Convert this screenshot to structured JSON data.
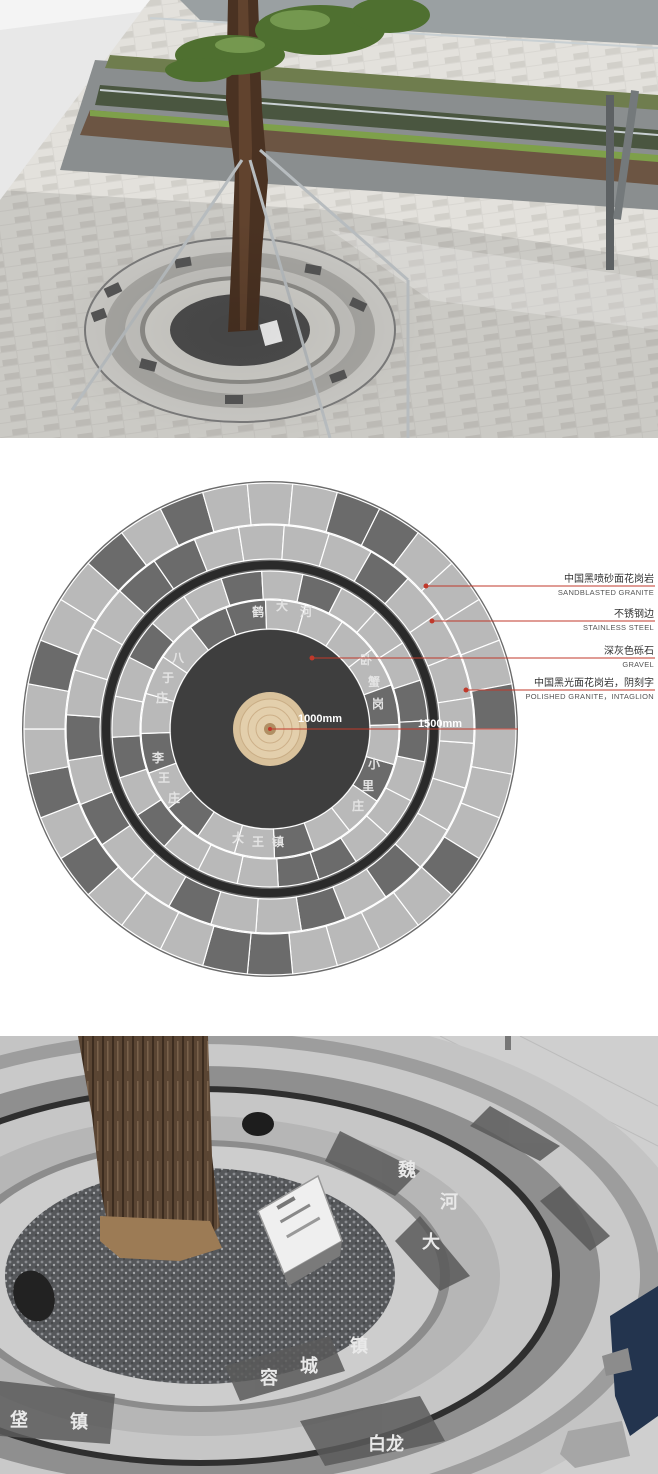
{
  "plan": {
    "annotations": [
      {
        "cn": "中国黑喷砂面花岗岩",
        "en": "SANDBLASTED GRANITE"
      },
      {
        "cn": "不锈钢边",
        "en": "STAINLESS STEEL"
      },
      {
        "cn": "深灰色砾石",
        "en": "GRAVEL"
      },
      {
        "cn": "中国黑光面花岗岩，阴刻字",
        "en": "POLISHED GRANITE，INTAGLION"
      }
    ],
    "dimensions": {
      "inner": "1000mm",
      "outer": "1500mm"
    },
    "engraved": {
      "r1_a": "鹤",
      "r1_b": "大",
      "r1_c": "河",
      "r1_d": "卧",
      "r1_e": "蟹",
      "r1_f": "岗",
      "r1_g": "小",
      "r1_h": "里",
      "r1_i": "庄",
      "r1_j": "大",
      "r1_k": "王",
      "r1_l": "镇",
      "r1_m": "李",
      "r1_n": "王",
      "r1_o": "庄",
      "r1_p": "八",
      "r1_q": "于",
      "r1_r": "庄"
    },
    "colors": {
      "accent": "#c0392b",
      "dark_tile": "#6b6b6b",
      "light_tile": "#b9b9b9",
      "gravel": "#3e3e3e"
    }
  },
  "photo_bottom": {
    "engraved": {
      "a": "容",
      "b": "城",
      "c": "镇",
      "d": "白龙",
      "e": "垡",
      "f": "镇",
      "g": "河",
      "h": "大",
      "i": "魏"
    }
  }
}
